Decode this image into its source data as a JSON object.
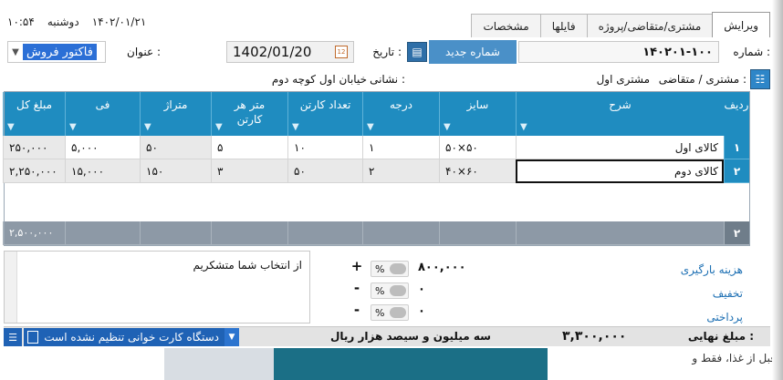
{
  "datetime": {
    "time": "۱۰:۵۴",
    "day": "دوشنبه",
    "date": "۱۴۰۲/۰۱/۲۱"
  },
  "tabs": [
    "ویرایش",
    "مشتری/متقاضی/پروژه",
    "فایلها",
    "مشخصات"
  ],
  "header": {
    "number_label": "شماره :",
    "number_value": "۱۴۰۲۰۱-۱۰۰",
    "new_number_button": "شماره جدید",
    "date_label": "تاریخ :",
    "date_value": "1402/01/20",
    "title_label": "عنوان :",
    "title_value": "فاکتور فروش",
    "customer_label": "مشتری / متقاضی :",
    "customer_value": "مشتری اول",
    "address_label": "نشانی :",
    "address_value": "خیابان اول کوچه دوم"
  },
  "grid": {
    "columns": [
      "ردیف",
      "شرح",
      "سایز",
      "درجه",
      "تعداد کارتن",
      "متر هر کارتن",
      "متراژ",
      "فی",
      "مبلغ کل"
    ],
    "rows": [
      {
        "idx": "۱",
        "desc": "کالای اول",
        "size": "۵۰×۵۰",
        "grade": "۱",
        "cartons": "۱۰",
        "per_carton": "۵",
        "area": "۵۰",
        "price": "۵,۰۰۰",
        "total": "۲۵۰,۰۰۰"
      },
      {
        "idx": "۲",
        "desc": "کالای دوم",
        "size": "۴۰×۶۰",
        "grade": "۲",
        "cartons": "۵۰",
        "per_carton": "۳",
        "area": "۱۵۰",
        "price": "۱۵,۰۰۰",
        "total": "۲,۲۵۰,۰۰۰"
      }
    ],
    "footer": {
      "idx": "۲",
      "total": "۲,۵۰۰,۰۰۰"
    }
  },
  "notes": "از انتخاب شما متشکریم",
  "charges": [
    {
      "label": "هزینه بارگیری",
      "sign": "+",
      "pct": "%",
      "amount": "۸۰۰,۰۰۰"
    },
    {
      "label": "تخفیف",
      "sign": "-",
      "pct": "%",
      "amount": "۰"
    },
    {
      "label": "پرداختی",
      "sign": "-",
      "pct": "%",
      "amount": "۰"
    }
  ],
  "status": {
    "card_reader": "دستگاه کارت خوانی تنظیم نشده است",
    "amount_words": "سه میلیون و سیصد  هزار  ریال",
    "final_amount": "۳,۳۰۰,۰۰۰",
    "final_label": "مبلغ نهایی :"
  },
  "strip": {
    "text": "قبل از غذا، فقط و"
  }
}
